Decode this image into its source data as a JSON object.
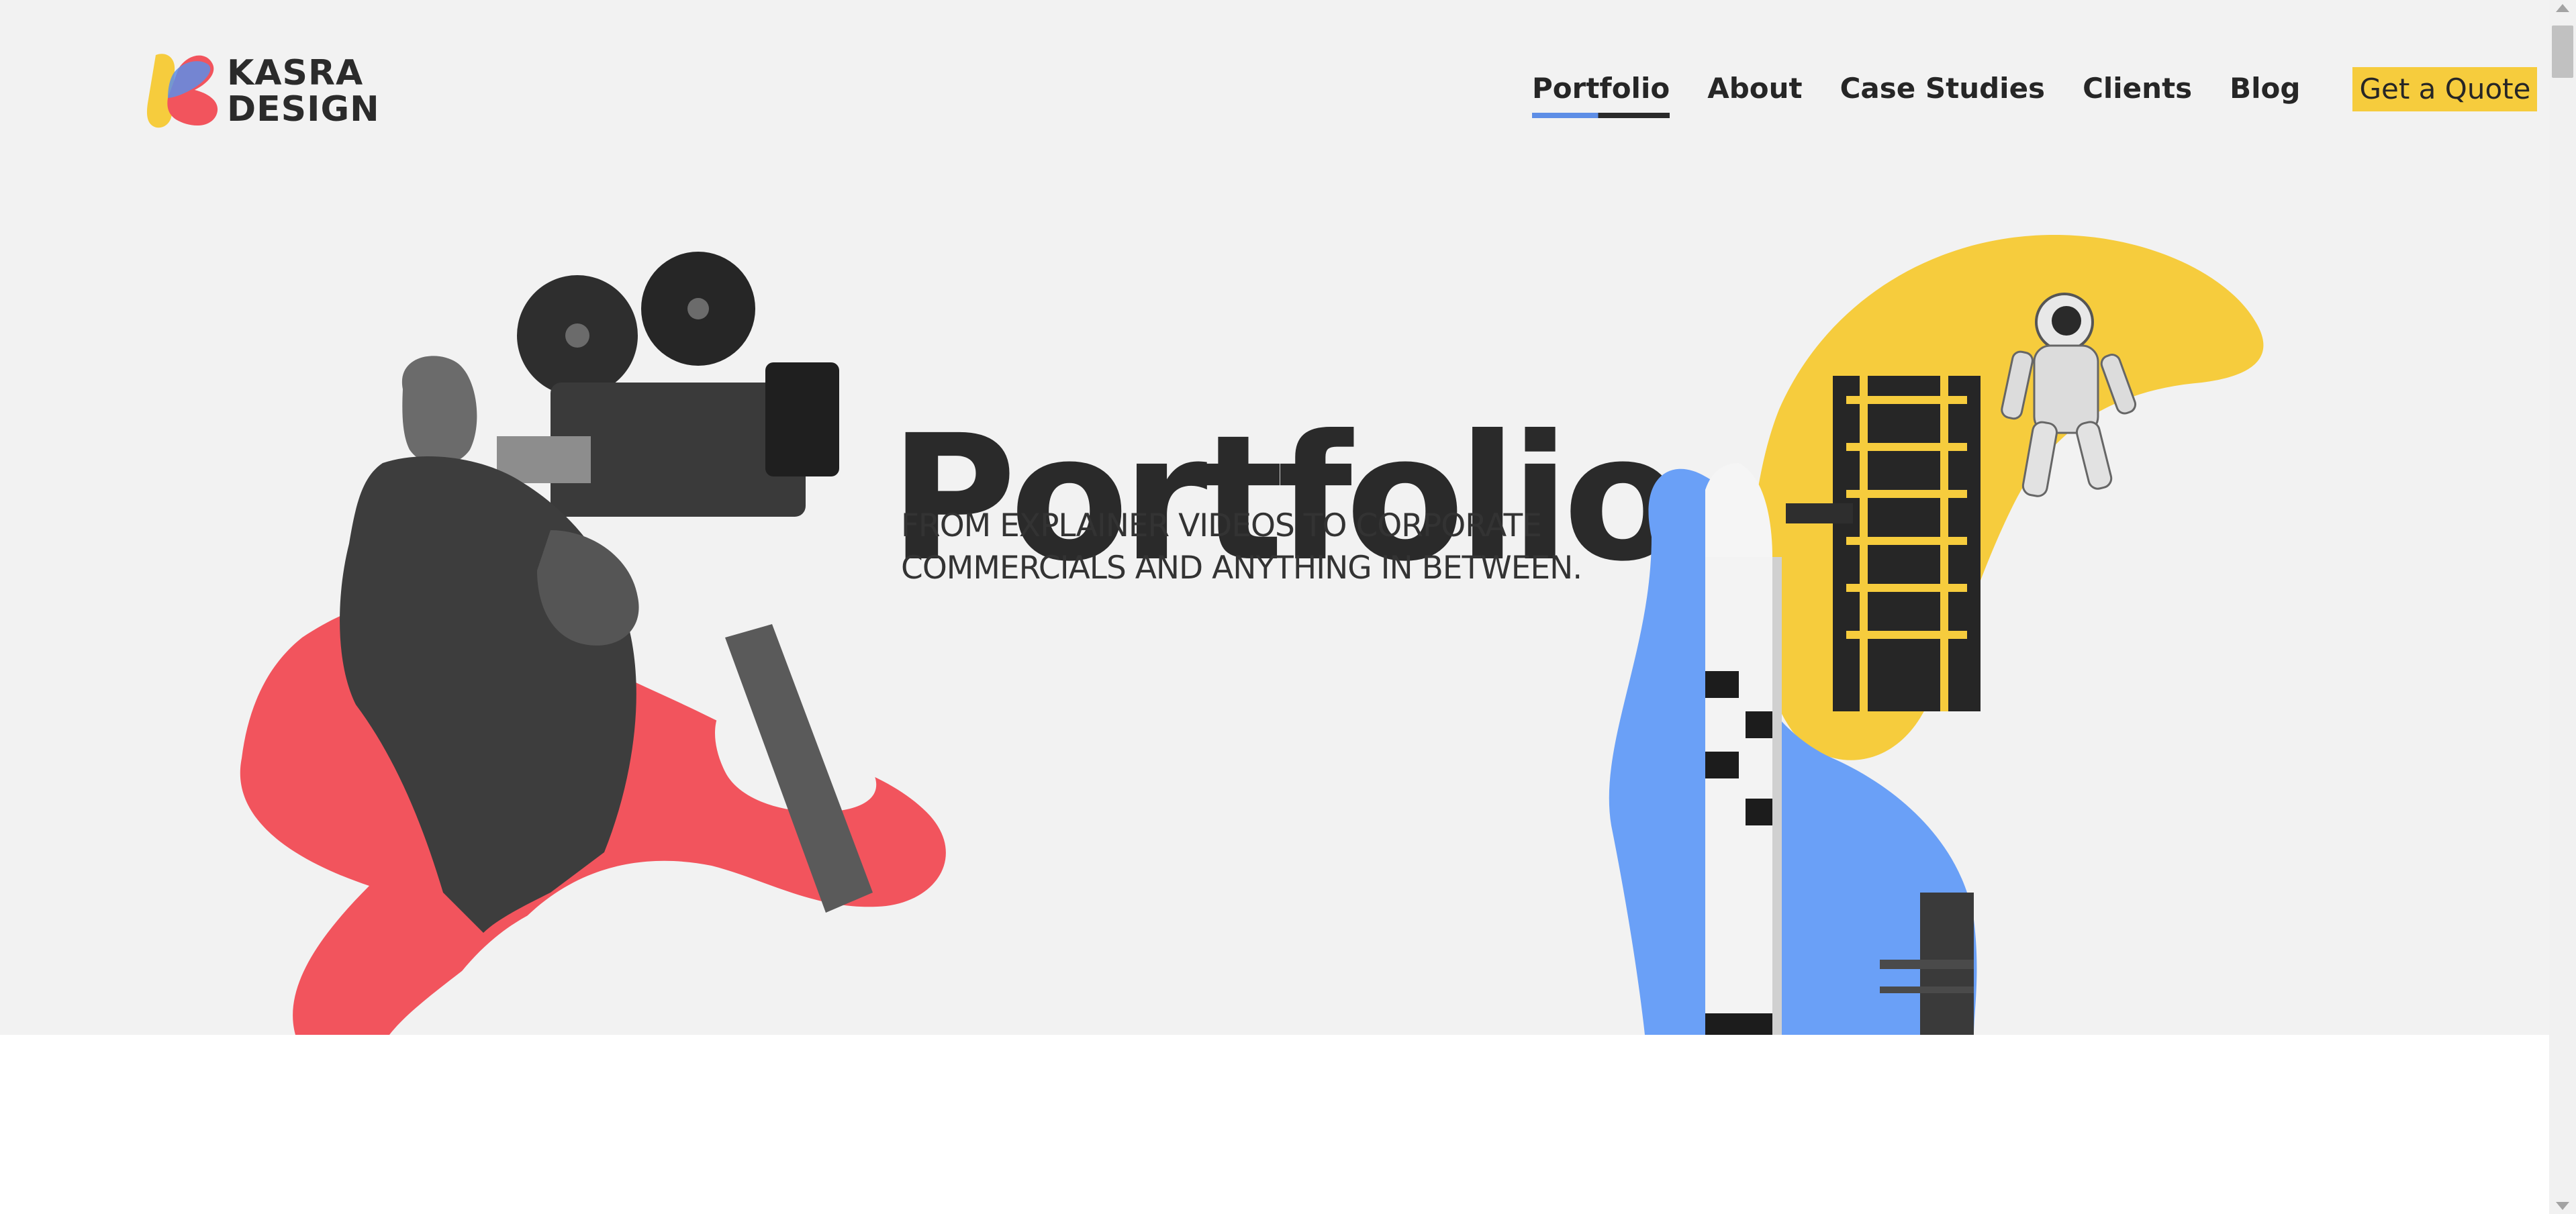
{
  "brand": {
    "line1": "KASRA",
    "line2": "DESIGN",
    "colors": {
      "blue": "#5e8ee6",
      "red": "#f2545d",
      "yellow": "#f6cc3d",
      "dark": "#2b2b2b"
    }
  },
  "nav": {
    "items": [
      {
        "label": "Portfolio",
        "active": true
      },
      {
        "label": "About"
      },
      {
        "label": "Case Studies"
      },
      {
        "label": "Clients"
      },
      {
        "label": "Blog"
      }
    ],
    "cta": "Get a Quote"
  },
  "hero": {
    "title": "Portfolio",
    "subtitle_line1": "FROM EXPLAINER VIDEOS TO CORPORATE",
    "subtitle_line2": "COMMERCIALS AND ANYTHING IN BETWEEN.",
    "background": "#f2f2f2"
  },
  "icons": {
    "scroll_up": "arrow-up-icon",
    "scroll_down": "arrow-down-icon"
  }
}
